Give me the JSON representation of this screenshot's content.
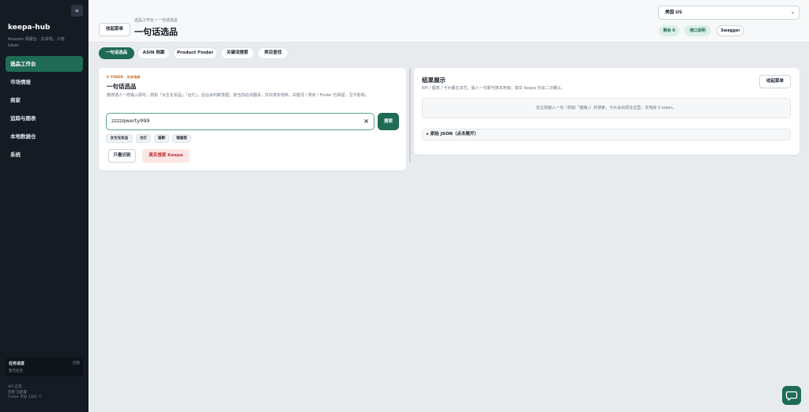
{
  "sidebar": {
    "collapse_icon": "«",
    "brand": "keepa-hub",
    "subtitle": "Amazon 情报台 · 先本地，少烧 token",
    "items": [
      {
        "label": "选品工作台",
        "active": true
      },
      {
        "label": "市场情报"
      },
      {
        "label": "商家"
      },
      {
        "label": "追踪与图表"
      },
      {
        "label": "本地数据仓"
      },
      {
        "label": "系统"
      }
    ],
    "task_panel": {
      "title": "任务进度",
      "close": "已隐",
      "empty": "暂无任务"
    },
    "status": [
      "API 正常",
      "密钥 已配置",
      "Finder 字段 1361 个"
    ]
  },
  "header": {
    "collapse_menu": "收起菜单",
    "breadcrumb": "选品工作台 / 一句话选品",
    "title": "一句话选品",
    "region": "美国 US",
    "remaining": "剩余 0",
    "health": "接口说明",
    "swagger": "Swagger"
  },
  "tabs": [
    {
      "label": "一句话选品",
      "active": true
    },
    {
      "label": "ASIN 档案"
    },
    {
      "label": "Product Finder"
    },
    {
      "label": "关键词搜索"
    },
    {
      "label": "类目查找"
    }
  ],
  "query_card": {
    "eyebrow": "0 TOKEN · 先本地库",
    "title": "一句话选品",
    "description": "像搜通人一样输入即可，例如「女生化妆品」「台灯」，后台会判断意图，按当前站点翻译，并先搜本地库。关键词 / 类目 / Finder 仍保留，互不影响。",
    "input_value": "zzzzqwerty999",
    "clear_icon": "×",
    "search_button": "搜索",
    "chips": [
      "女生化妆品",
      "台灯",
      "猫粮",
      "瑜伽垫"
    ],
    "recognize_button": "只看识别",
    "real_search_button": "真实搜索 Keepa"
  },
  "results_card": {
    "title": "结果展示",
    "description": "KPI / 图表 / 卡片都在本栏。输入一句即可搜本地库；真实 Keepa 仍会二次确认。",
    "collapse_button": "收起菜单",
    "empty_text": "在左侧输入一句（例如「猫粮」）并搜索，卡片会出现在这里。本地库 0 token。",
    "raw_json": "▸ 原始 JSON（点击展开）"
  },
  "colors": {
    "accent": "#1f6b55",
    "sidebar_bg": "#141b23",
    "danger_text": "#c03434",
    "eyebrow": "#c0641c"
  },
  "icons": {
    "collapse": "collapse-sidebar-icon",
    "chat": "chat-icon",
    "select": "chevron-down-icon"
  }
}
